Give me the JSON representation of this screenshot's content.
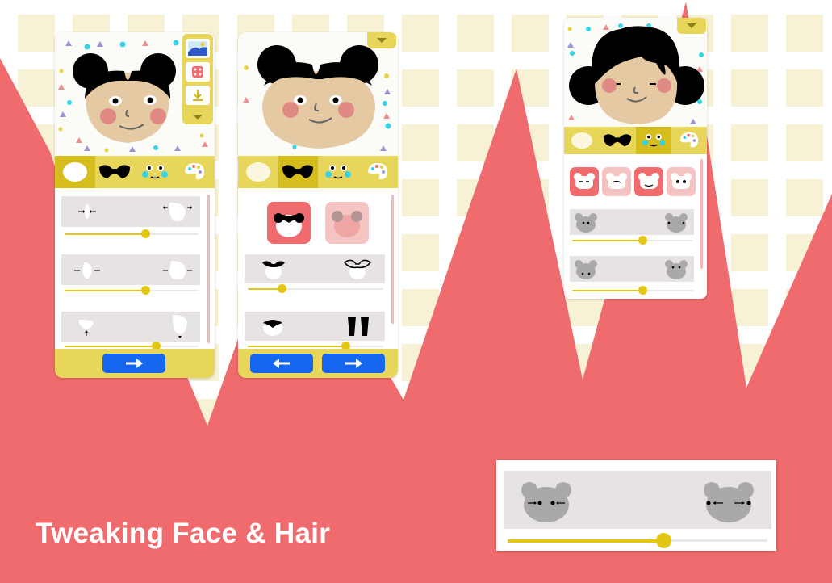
{
  "caption": "Tweaking Face & Hair",
  "colors": {
    "background_red": "#f06b6d",
    "accent_yellow": "#e7d65a",
    "active_tab": "#d4bd1c",
    "slider_yellow": "#e2c60f",
    "button_blue": "#1567f0",
    "skin": "#e4c9a3",
    "cheek": "#e08a85",
    "hair": "#000000"
  },
  "screens": [
    {
      "name": "face-shape-editor",
      "tabs": [
        {
          "icon": "face-shape-icon",
          "active": true
        },
        {
          "icon": "hair-icon",
          "active": false
        },
        {
          "icon": "features-icon",
          "active": false
        },
        {
          "icon": "palette-icon",
          "active": false
        }
      ],
      "toolbar": [
        "background-icon",
        "dice-icon",
        "download-icon",
        "chevron-down-icon"
      ],
      "sliders": [
        {
          "label": "face-width",
          "value": 0.6
        },
        {
          "label": "jaw-width",
          "value": 0.6
        },
        {
          "label": "chin-length",
          "value": 0.68
        }
      ],
      "footer_buttons": [
        "next-arrow"
      ]
    },
    {
      "name": "hair-editor",
      "tabs": [
        {
          "icon": "face-shape-icon",
          "active": false
        },
        {
          "icon": "hair-icon",
          "active": true
        },
        {
          "icon": "features-icon",
          "active": false
        },
        {
          "icon": "palette-icon",
          "active": false
        }
      ],
      "hair_styles": [
        "buns-style",
        "ears-style"
      ],
      "sliders": [
        {
          "label": "bun-size",
          "value": 0.25
        },
        {
          "label": "hair-volume",
          "value": 0.72
        }
      ],
      "footer_buttons": [
        "back-arrow",
        "next-arrow"
      ]
    },
    {
      "name": "features-editor",
      "tabs": [
        {
          "icon": "face-shape-icon",
          "active": false
        },
        {
          "icon": "hair-icon",
          "active": false
        },
        {
          "icon": "features-icon",
          "active": true
        },
        {
          "icon": "palette-icon",
          "active": false
        }
      ],
      "feature_options": [
        "eyes-option",
        "eyes-closed-option",
        "mouth-option",
        "blank-eyes-option"
      ],
      "sliders": [
        {
          "label": "eye-spacing",
          "value": 0.58
        },
        {
          "label": "eye-height",
          "value": 0.58
        }
      ]
    }
  ],
  "zoom_slider": {
    "label": "eye-spacing",
    "value": 0.6
  }
}
